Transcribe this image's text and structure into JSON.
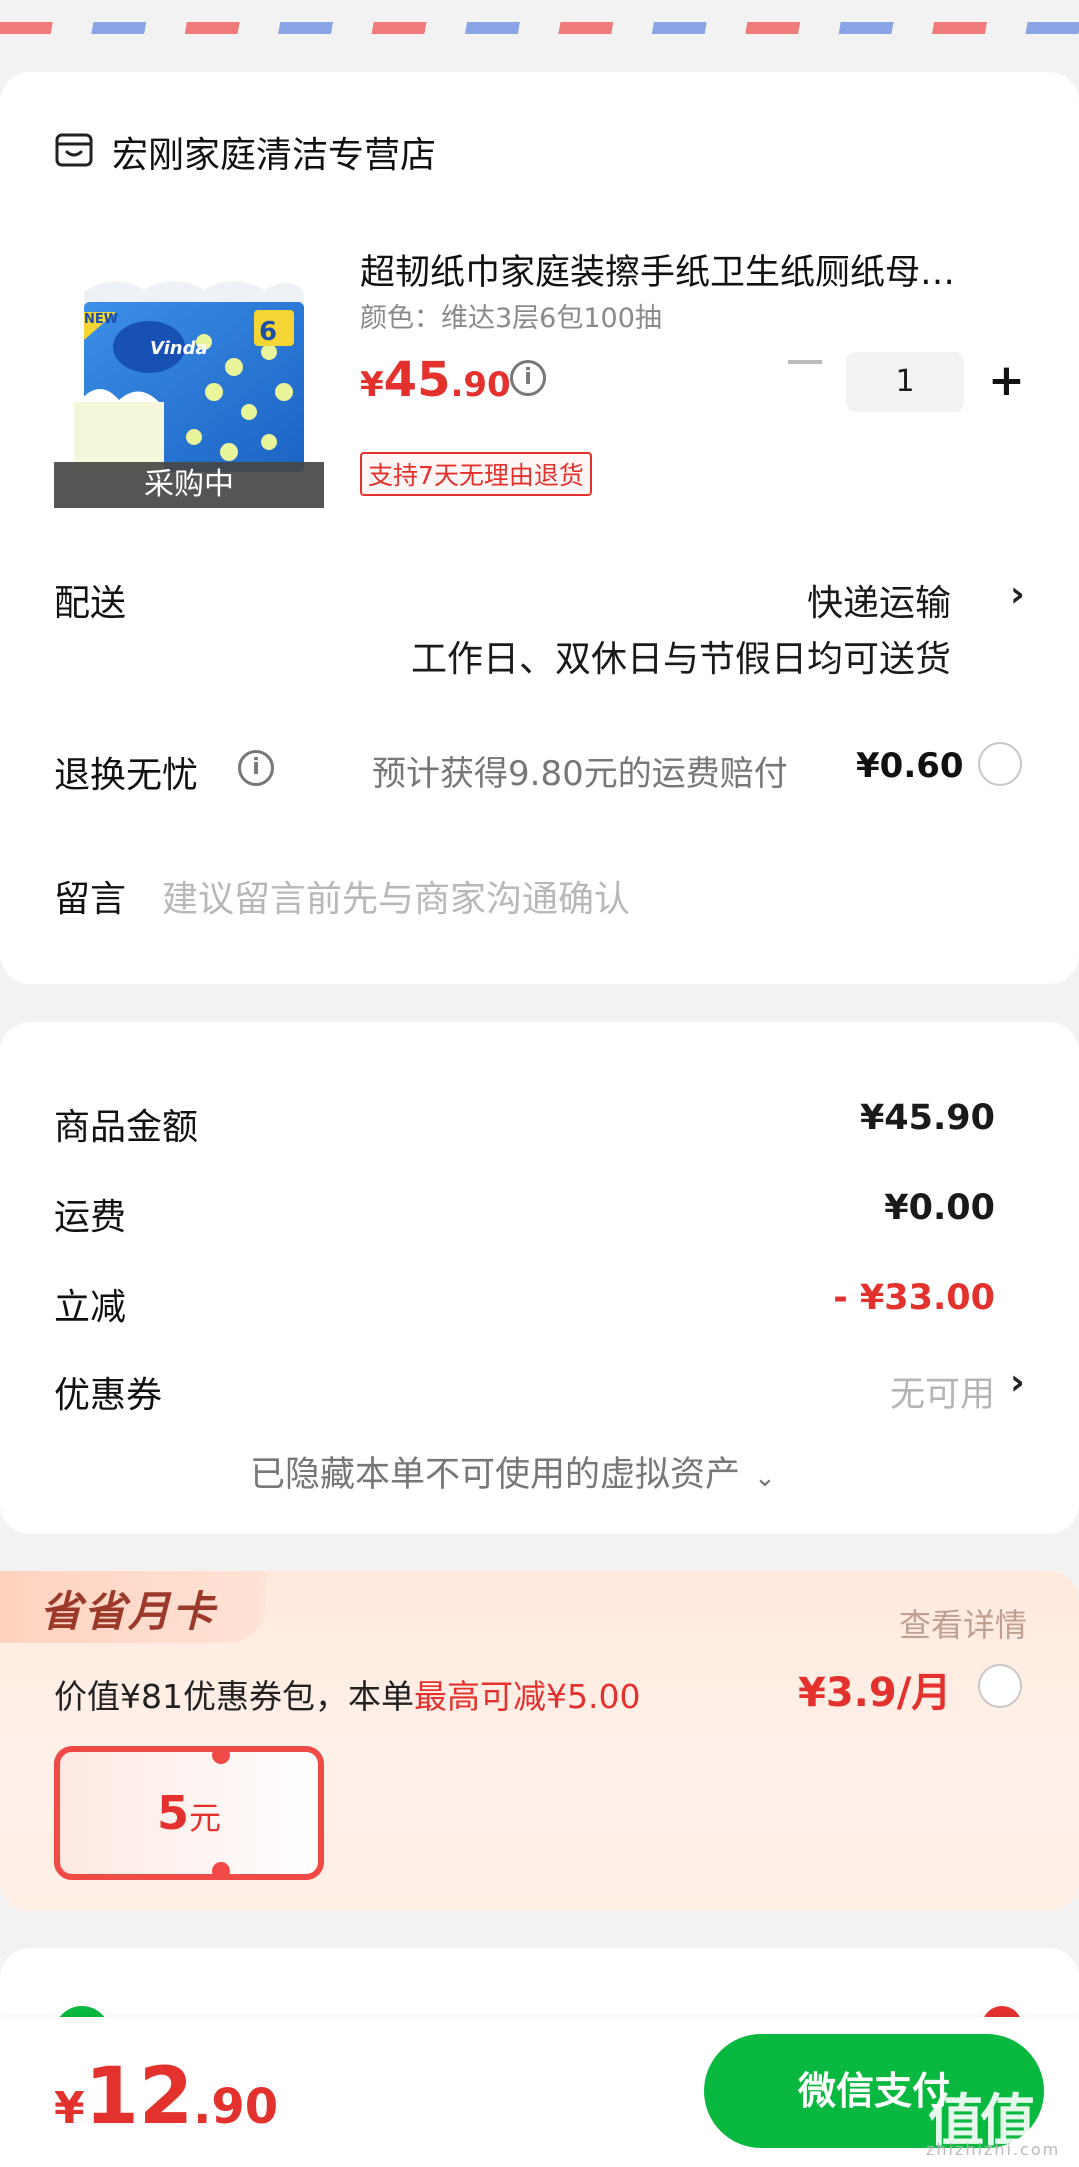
{
  "store": {
    "name": "宏刚家庭清洁专营店",
    "icon": "store-icon"
  },
  "product": {
    "title": "超韧纸巾家庭装擦手纸卫生纸厕纸母…",
    "spec": "颜色：维达3层6包100抽",
    "price_symbol": "¥",
    "price_int": "45",
    "price_dec": ".90",
    "quantity": "1",
    "return_policy": "支持7天无理由退货",
    "status_overlay": "采购中",
    "image_brand": "Vinda",
    "image_tag": "NEW"
  },
  "delivery": {
    "label": "配送",
    "method": "快递运输",
    "note": "工作日、双休日与节假日均可送货"
  },
  "insurance": {
    "label": "退换无忧",
    "desc": "预计获得9.80元的运费赔付",
    "price": "¥0.60"
  },
  "message": {
    "label": "留言",
    "placeholder": "建议留言前先与商家沟通确认"
  },
  "summary": {
    "goods_label": "商品金额",
    "goods_value": "¥45.90",
    "shipping_label": "运费",
    "shipping_value": "¥0.00",
    "discount_label": "立减",
    "discount_value": "- ¥33.00",
    "coupon_label": "优惠券",
    "coupon_value": "无可用",
    "hidden_assets": "已隐藏本单不可使用的虚拟资产"
  },
  "monthly_card": {
    "badge": "省省月卡",
    "details_link": "查看详情",
    "desc_prefix": "价值¥81优惠券包，本单",
    "desc_highlight": "最高可减¥5.00",
    "price": "¥3.9/月",
    "coupon_amount": "5",
    "coupon_unit": "元"
  },
  "footer": {
    "total_symbol": "¥",
    "total_int": "12",
    "total_dec": ".90",
    "pay_button": "微信支付"
  },
  "watermark": {
    "main": "值值值",
    "sub": "zhizhizhi.com"
  },
  "colors": {
    "accent_red": "#e3322e",
    "wechat_green": "#09b83e"
  }
}
